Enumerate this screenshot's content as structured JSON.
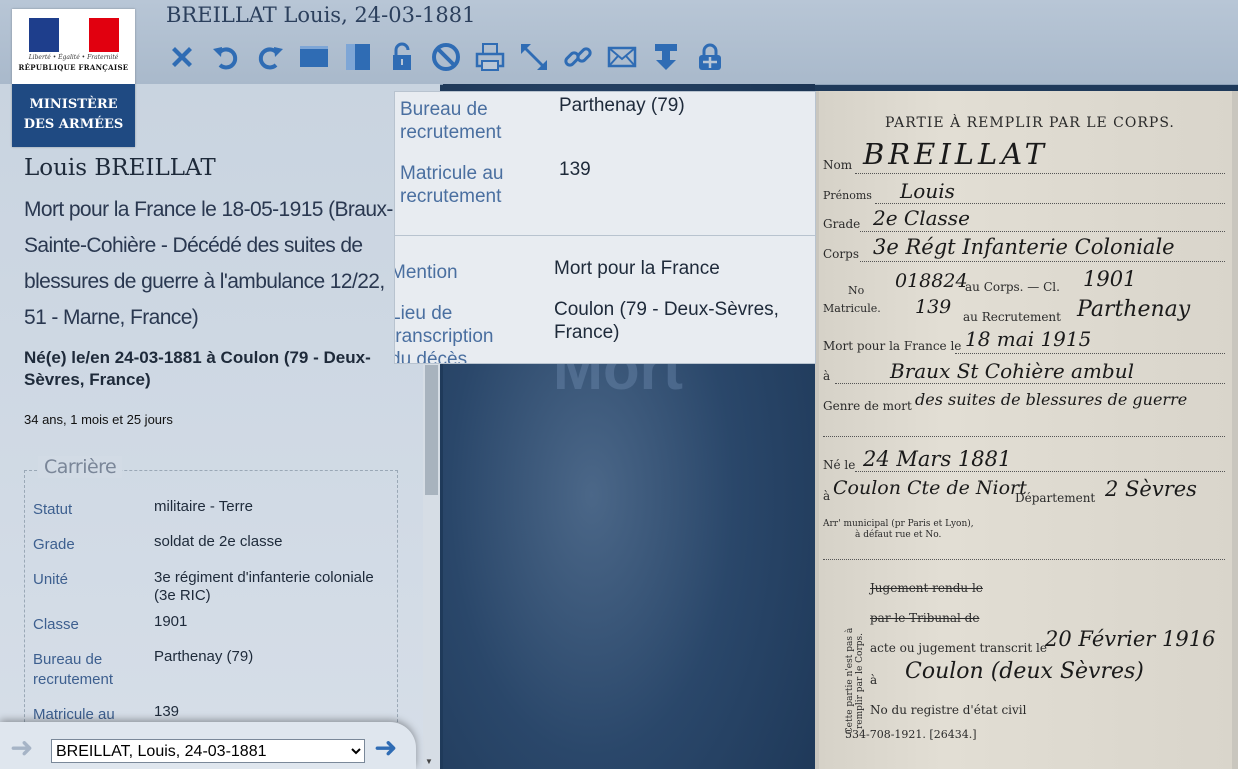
{
  "header": {
    "title": "BREILLAT Louis, 24-03-1881",
    "logo": {
      "motto": "Liberté • Égalité • Fraternité",
      "republic": "RÉPUBLIQUE FRANÇAISE",
      "ministry_line1": "MINISTÈRE",
      "ministry_line2": "DES ARMÉES"
    },
    "toolbar": [
      {
        "name": "close-icon"
      },
      {
        "name": "rotate-left-icon"
      },
      {
        "name": "rotate-right-icon"
      },
      {
        "name": "view-horizontal-icon"
      },
      {
        "name": "view-vertical-icon"
      },
      {
        "name": "unlock-icon"
      },
      {
        "name": "forbidden-icon"
      },
      {
        "name": "print-icon"
      },
      {
        "name": "fullscreen-icon"
      },
      {
        "name": "link-icon"
      },
      {
        "name": "mail-icon"
      },
      {
        "name": "download-icon"
      },
      {
        "name": "lock-icon"
      }
    ]
  },
  "person": {
    "name": "Louis BREILLAT",
    "death": "Mort pour la France le 18-05-1915 (Braux-Sainte-Cohière - Décédé des suites de blessures de guerre à l'ambulance 12/22, 51 - Marne, France)",
    "birth": "Né(e) le/en 24-03-1881 à Coulon (79 - Deux-Sèvres, France)",
    "age": "34 ans, 1 mois et 25 jours"
  },
  "career": {
    "legend": "Carrière",
    "rows": [
      {
        "label": "Statut",
        "value": "militaire - Terre"
      },
      {
        "label": "Grade",
        "value": "soldat de 2e classe"
      },
      {
        "label": "Unité",
        "value": "3e régiment d'infanterie coloniale (3e RIC)"
      },
      {
        "label": "Classe",
        "value": "1901"
      },
      {
        "label": "Bureau de recrutement",
        "value": "Parthenay (79)"
      },
      {
        "label": "Matricule au",
        "value": "139"
      }
    ]
  },
  "popup": {
    "rows": [
      {
        "label": "Bureau de recrutement",
        "value": "Parthenay (79)"
      },
      {
        "label": "Matricule au recrutement",
        "value": "139"
      },
      {
        "label": "Mention",
        "value": "Mort pour la France"
      },
      {
        "label": "Lieu de transcription du décès",
        "value": "Coulon (79 - Deux-Sèvres, France)"
      }
    ]
  },
  "nav": {
    "selected": "BREILLAT, Louis, 24-03-1881"
  },
  "background_text": "Mort",
  "scan": {
    "heading": "PARTIE À REMPLIR PAR LE CORPS.",
    "nom_label": "Nom",
    "nom": "BREILLAT",
    "prenoms_label": "Prénoms",
    "prenoms": "Louis",
    "grade_label": "Grade",
    "grade": "2e Classe",
    "corps_label": "Corps",
    "corps": "3e Régt Infanterie Coloniale",
    "no_label": "No",
    "no_value": "018824",
    "au_corps": "au Corps. — Cl.",
    "classe": "1901",
    "matricule_label": "Matricule.",
    "matricule_value": "139",
    "au_recrutement": "au Recrutement",
    "recrutement": "Parthenay",
    "mort_label": "Mort pour la France le",
    "mort_date": "18 mai 1915",
    "a_label": "à",
    "lieu": "Braux St Cohière ambul",
    "genre_label": "Genre de mort",
    "genre": "des suites de blessures de guerre",
    "ne_label": "Né le",
    "ne_date": "24 Mars 1881",
    "ne_a": "Coulon Cte de Niort",
    "departement_label": "Département",
    "departement": "2 Sèvres",
    "arr_label": "Arr' municipal (pr Paris et Lyon),",
    "arr_label2": "à défaut rue et No.",
    "side_note": "Cette partie n'est pas à remplir par le Corps.",
    "jugement": "Jugement rendu le",
    "tribunal": "par le Tribunal de",
    "acte": "acte ou jugement transcrit le",
    "transcrit_date": "20 Février 1916",
    "transcrit_lieu": "Coulon (deux Sèvres)",
    "registre": "No du registre d'état civil",
    "footer": "534-708-1921. [26434.]"
  },
  "colors": {
    "accent": "#2f6cb4",
    "panel": "#d2dbe5",
    "ministry": "#1f4a82"
  }
}
